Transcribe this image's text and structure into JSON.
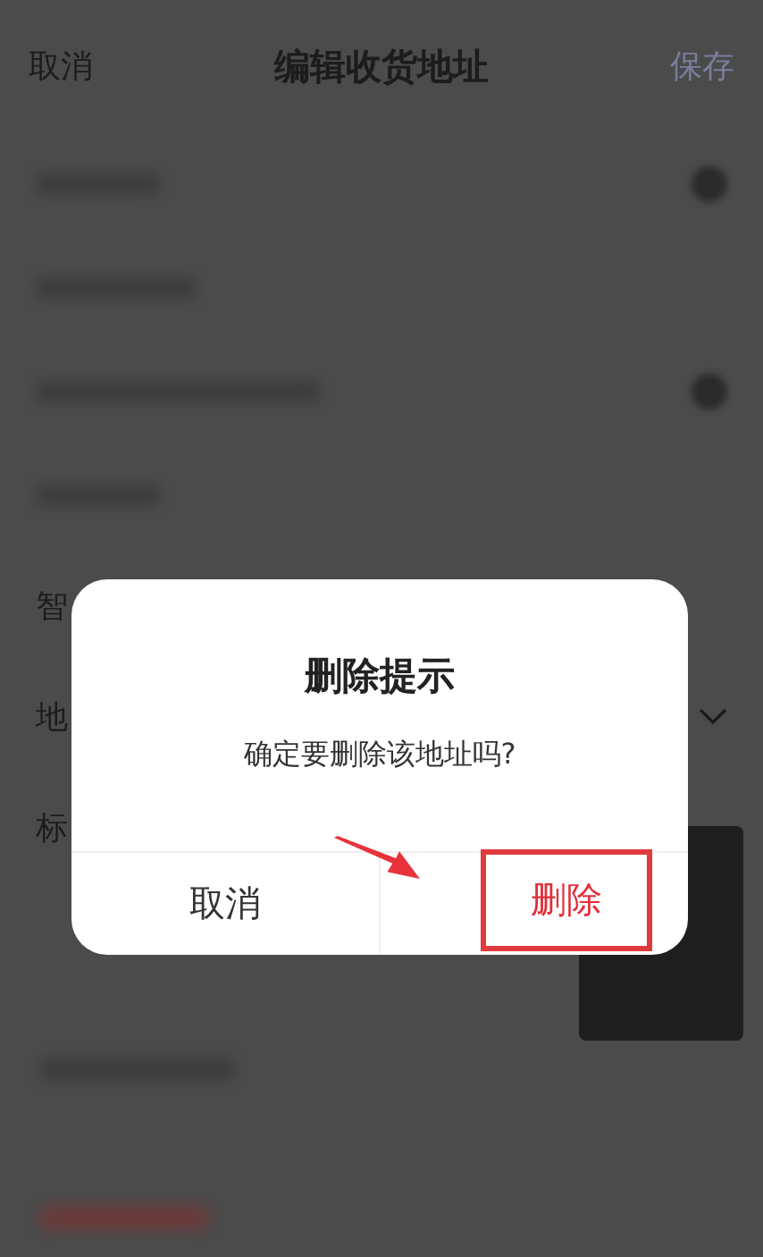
{
  "header": {
    "cancel": "取消",
    "title": "编辑收货地址",
    "save": "保存"
  },
  "form_rows": [
    {
      "kind": "blurredicon"
    },
    {
      "kind": "blurred"
    },
    {
      "kind": "blurredicon"
    },
    {
      "kind": "blurred"
    },
    {
      "kind": "label",
      "label": "智"
    },
    {
      "kind": "select",
      "label": "地"
    },
    {
      "kind": "label",
      "label": "标"
    }
  ],
  "dialog": {
    "title": "删除提示",
    "message": "确定要删除该地址吗?",
    "buttons": [
      {
        "label": "取消",
        "kind": "normal"
      },
      {
        "label": "删除",
        "kind": "danger",
        "highlighted": true
      }
    ]
  }
}
